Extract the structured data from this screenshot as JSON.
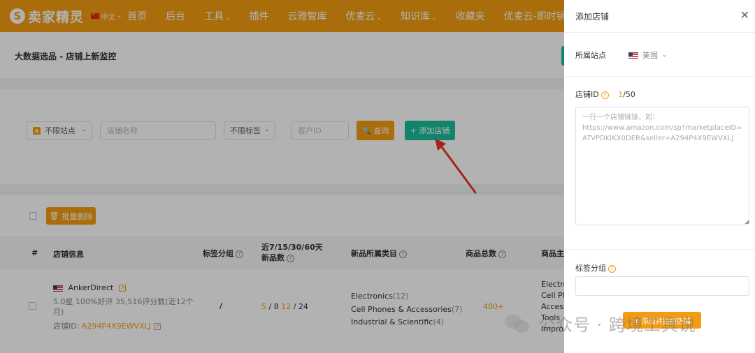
{
  "brand": {
    "logo_letter": "S",
    "name": "卖家精灵"
  },
  "lang": "中文",
  "nav": [
    "首页",
    "后台",
    "工具",
    "插件",
    "云雅智库",
    "优麦云",
    "知识库",
    "收藏夹",
    "优麦云-即时销售"
  ],
  "nav_with_dropdown": [
    false,
    false,
    true,
    false,
    false,
    true,
    true,
    false,
    false
  ],
  "page_title": "大数据选品 - 店铺上新监控",
  "filters": {
    "site_select": "不限站点",
    "store_name_placeholder": "店铺名称",
    "tag_select": "不限标签",
    "client_id_placeholder": "客户ID",
    "query_button": "查询",
    "add_store_button": "+ 添加店铺"
  },
  "bulk_delete_button": "批量删除",
  "table": {
    "headers": {
      "index": "#",
      "store_info": "店铺信息",
      "tag_group": "标签分组",
      "new_counts_line1": "近7/15/30/60天",
      "new_counts_line2": "新品数",
      "category": "新品所属类目",
      "total_products": "商品总数",
      "main": "商品主"
    },
    "row": {
      "store_name": "AnkerDirect",
      "rating_line1": "5.0星  100%好评  35,516评分数(近12个",
      "rating_line2": "月)",
      "store_id_label": "店铺ID: ",
      "store_id": "A294P4X9EWVXLJ",
      "tag_group": "/",
      "counts": {
        "d7": "5",
        "d15": "8",
        "d30": "12",
        "d60": "24"
      },
      "categories": [
        {
          "name": "Electronics",
          "count": "(12)"
        },
        {
          "name": "Cell Phones & Accessories",
          "count": "(7)"
        },
        {
          "name": "Industrial & Scientific",
          "count": "(4)"
        }
      ],
      "total": "400+",
      "main_items": [
        "Electro",
        "Cell Ph",
        "Access",
        "Tools",
        "Impro"
      ]
    }
  },
  "drawer": {
    "title": "添加店铺",
    "site_label": "所属站点",
    "site_value": "美国",
    "store_id_label": "店铺ID",
    "store_id_count_used": "1",
    "store_id_count_total": "/50",
    "textarea_placeholder": "一行一个店铺链接，如：\nhttps://www.amazon.com/sp?marketplaceID=ATVPDKIKX0DER&seller=A294P4X9EWVXLJ",
    "tag_label": "标签分组",
    "submit_button": "+ 添加并监控店铺"
  },
  "watermark": "公众号 · 跨境工具说",
  "colors": {
    "brand_orange": "#f39c12",
    "teal": "#19be9b",
    "arrow_red": "#e8372a"
  }
}
